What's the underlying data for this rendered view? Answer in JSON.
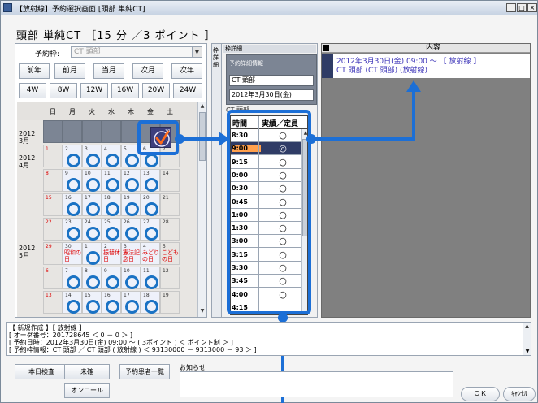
{
  "titlebar": {
    "title": "【放射線】予約選択画面 [頭部 単純CT]",
    "minimize": "_",
    "maximize": "□",
    "close": "×"
  },
  "heading": "頭部 単純CT ［15 分 ／3 ポイント ］",
  "calendar": {
    "reserve_frame_label": "予約枠:",
    "reserve_frame_value": "CT 頭部",
    "nav_row1": [
      "前年",
      "前月",
      "当月",
      "次月",
      "次年"
    ],
    "nav_row2": [
      "4W",
      "8W",
      "12W",
      "16W",
      "20W",
      "24W"
    ],
    "dow": [
      "日",
      "月",
      "火",
      "水",
      "木",
      "金",
      "土"
    ],
    "months": [
      {
        "label": "2012\n3月"
      },
      {
        "label": "2012\n4月"
      },
      {
        "label": "2012\n5月"
      }
    ],
    "holidays": [
      "昭和の日",
      "振替休日",
      "憲法記念日",
      "みどりの日",
      "こどもの日"
    ],
    "selected_date_number": "30"
  },
  "detail": {
    "tab_label": "枠詳細",
    "header": "枠詳細",
    "info_title": "予約詳細情報",
    "ct_name": "CT 頭部",
    "date": "2012年3月30日(金)",
    "frame_label": "CT 頭部",
    "col_time": "時間",
    "col_status": "実績／定員",
    "rows": [
      {
        "time": "8:30",
        "mark": "○"
      },
      {
        "time": "9:00",
        "mark": "◎"
      },
      {
        "time": "9:15",
        "mark": "○"
      },
      {
        "time": "0:00",
        "mark": "○"
      },
      {
        "time": "0:30",
        "mark": "○"
      },
      {
        "time": "0:45",
        "mark": "○"
      },
      {
        "time": "1:00",
        "mark": "○"
      },
      {
        "time": "1:30",
        "mark": "○"
      },
      {
        "time": "3:00",
        "mark": "○"
      },
      {
        "time": "3:15",
        "mark": "○"
      },
      {
        "time": "3:30",
        "mark": "○"
      },
      {
        "time": "3:45",
        "mark": "○"
      },
      {
        "time": "4:00",
        "mark": "○"
      },
      {
        "time": "4:15",
        "mark": ""
      }
    ]
  },
  "content": {
    "header": "内容",
    "line1": "2012年3月30日(金) 09:00 ～ 【 放射線 】",
    "line2": "CT 頭部 (CT 頭部) (放射線)"
  },
  "log": {
    "lines": [
      "【 新規作成 】【 放射線 】",
      "[ オーダ番号：201728645 ＜ 0 － 0 ＞ ]",
      "[ 予約日時：2012年3月30日(金) 09:00 ～ ( 3ポイント ) ＜ ポイント制 ＞ ]",
      "[ 予約枠情報：CT 頭部 ／ CT 頭部 ( 放射線 ) ＜ 93130000 － 9313000 － 93 ＞ ]"
    ]
  },
  "buttons": {
    "today_exam": "本日検査",
    "unconfirmed": "未確",
    "reserved_patients": "予約患者一覧",
    "on_call": "オンコール",
    "notice": "お知らせ",
    "ok": "ＯＫ",
    "cancel": "ｷｬﾝｾﾙ"
  }
}
